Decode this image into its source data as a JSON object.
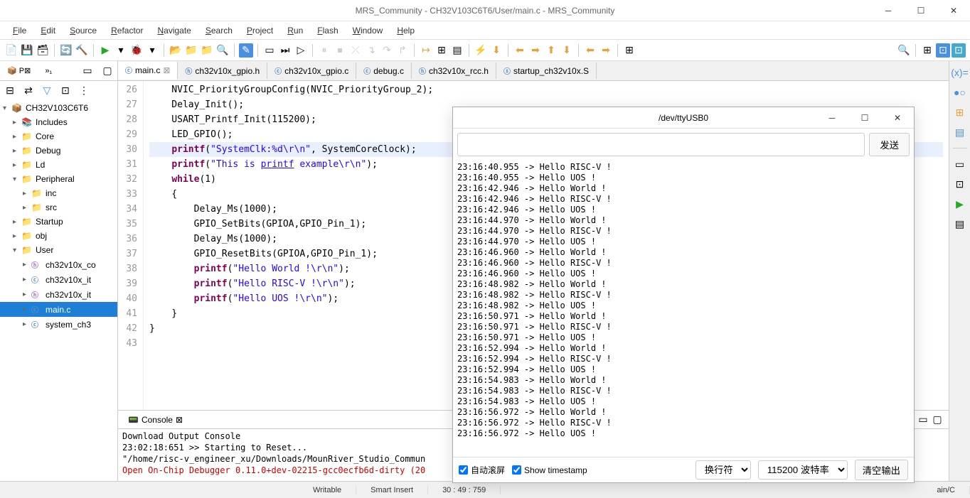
{
  "window": {
    "title": "MRS_Community - CH32V103C6T6/User/main.c - MRS_Community"
  },
  "menu": {
    "items": [
      "File",
      "Edit",
      "Source",
      "Refactor",
      "Navigate",
      "Search",
      "Project",
      "Run",
      "Flash",
      "Window",
      "Help"
    ]
  },
  "project_tree": {
    "root": "CH32V103C6T6",
    "items": [
      {
        "label": "Includes",
        "level": 1,
        "icon": "lib",
        "arrow": "▸"
      },
      {
        "label": "Core",
        "level": 1,
        "icon": "folder",
        "arrow": "▸"
      },
      {
        "label": "Debug",
        "level": 1,
        "icon": "folder",
        "arrow": "▸"
      },
      {
        "label": "Ld",
        "level": 1,
        "icon": "folder",
        "arrow": "▸"
      },
      {
        "label": "Peripheral",
        "level": 1,
        "icon": "folder",
        "arrow": "▾"
      },
      {
        "label": "inc",
        "level": 2,
        "icon": "folder",
        "arrow": "▸"
      },
      {
        "label": "src",
        "level": 2,
        "icon": "folder",
        "arrow": "▸"
      },
      {
        "label": "Startup",
        "level": 1,
        "icon": "folder",
        "arrow": "▸"
      },
      {
        "label": "obj",
        "level": 1,
        "icon": "folder",
        "arrow": "▸"
      },
      {
        "label": "User",
        "level": 1,
        "icon": "folder",
        "arrow": "▾"
      },
      {
        "label": "ch32v10x_co",
        "level": 2,
        "icon": "h",
        "arrow": "▸"
      },
      {
        "label": "ch32v10x_it",
        "level": 2,
        "icon": "c",
        "arrow": "▸"
      },
      {
        "label": "ch32v10x_it",
        "level": 2,
        "icon": "h",
        "arrow": "▸"
      },
      {
        "label": "main.c",
        "level": 2,
        "icon": "c",
        "arrow": "▸",
        "selected": true
      },
      {
        "label": "system_ch3",
        "level": 2,
        "icon": "c",
        "arrow": "▸"
      }
    ]
  },
  "editor": {
    "tabs": [
      {
        "label": "main.c",
        "icon": "c",
        "active": true,
        "close": "⊠"
      },
      {
        "label": "ch32v10x_gpio.h",
        "icon": "h"
      },
      {
        "label": "ch32v10x_gpio.c",
        "icon": "c"
      },
      {
        "label": "debug.c",
        "icon": "c"
      },
      {
        "label": "ch32v10x_rcc.h",
        "icon": "h"
      },
      {
        "label": "startup_ch32v10x.S",
        "icon": "s"
      }
    ],
    "line_start": 26,
    "lines": [
      {
        "n": 26,
        "html": "    NVIC_PriorityGroupConfig(NVIC_PriorityGroup_2);"
      },
      {
        "n": 27,
        "html": "    Delay_Init();"
      },
      {
        "n": 28,
        "html": "    USART_Printf_Init(115200);"
      },
      {
        "n": 29,
        "html": "    LED_GPIO();"
      },
      {
        "n": 30,
        "html": "    <span class='kw'>printf</span>(<span class='str'>\"SystemClk:%d\\r\\n\"</span>, SystemCoreClock);",
        "hl": true
      },
      {
        "n": 31,
        "html": "    <span class='kw'>printf</span>(<span class='str'>\"This is <u>printf</u> example\\r\\n\"</span>);"
      },
      {
        "n": 32,
        "html": "    <span class='kw'>while</span>(1)"
      },
      {
        "n": 33,
        "html": "    {"
      },
      {
        "n": 34,
        "html": "        Delay_Ms(1000);"
      },
      {
        "n": 35,
        "html": "        GPIO_SetBits(GPIOA,GPIO_Pin_1);"
      },
      {
        "n": 36,
        "html": "        Delay_Ms(1000);"
      },
      {
        "n": 37,
        "html": "        GPIO_ResetBits(GPIOA,GPIO_Pin_1);"
      },
      {
        "n": 38,
        "html": "        <span class='kw'>printf</span>(<span class='str'>\"Hello World !\\r\\n\"</span>);"
      },
      {
        "n": 39,
        "html": "        <span class='kw'>printf</span>(<span class='str'>\"Hello RISC-V !\\r\\n\"</span>);"
      },
      {
        "n": 40,
        "html": "        <span class='kw'>printf</span>(<span class='str'>\"Hello UOS !\\r\\n\"</span>);"
      },
      {
        "n": 41,
        "html": "    }"
      },
      {
        "n": 42,
        "html": "}"
      },
      {
        "n": 43,
        "html": ""
      }
    ]
  },
  "console": {
    "tab_label": "Console",
    "title": "Download Output Console",
    "lines": [
      {
        "text": "23:02:18:651 >> Starting to Reset...",
        "cls": ""
      },
      {
        "text": "\"/home/risc-v_engineer_xu/Downloads/MounRiver_Studio_Commun",
        "cls": ""
      },
      {
        "text": "Open On-Chip Debugger 0.11.0+dev-02215-gcc0ecfb6d-dirty (20",
        "cls": "err"
      }
    ]
  },
  "serial": {
    "title": "/dev/ttyUSB0",
    "send_label": "发送",
    "output": [
      "23:16:40.955 -> Hello RISC-V !",
      "23:16:40.955 -> Hello UOS !",
      "23:16:42.946 -> Hello World !",
      "23:16:42.946 -> Hello RISC-V !",
      "23:16:42.946 -> Hello UOS !",
      "23:16:44.970 -> Hello World !",
      "23:16:44.970 -> Hello RISC-V !",
      "23:16:44.970 -> Hello UOS !",
      "23:16:46.960 -> Hello World !",
      "23:16:46.960 -> Hello RISC-V !",
      "23:16:46.960 -> Hello UOS !",
      "23:16:48.982 -> Hello World !",
      "23:16:48.982 -> Hello RISC-V !",
      "23:16:48.982 -> Hello UOS !",
      "23:16:50.971 -> Hello World !",
      "23:16:50.971 -> Hello RISC-V !",
      "23:16:50.971 -> Hello UOS !",
      "23:16:52.994 -> Hello World !",
      "23:16:52.994 -> Hello RISC-V !",
      "23:16:52.994 -> Hello UOS !",
      "23:16:54.983 -> Hello World !",
      "23:16:54.983 -> Hello RISC-V !",
      "23:16:54.983 -> Hello UOS !",
      "23:16:56.972 -> Hello World !",
      "23:16:56.972 -> Hello RISC-V !",
      "23:16:56.972 -> Hello UOS !"
    ],
    "auto_scroll_label": "自动滚屏",
    "show_ts_label": "Show timestamp",
    "line_ending": "换行符",
    "baud_rate": "115200 波特率",
    "clear_label": "清空输出"
  },
  "statusbar": {
    "writable": "Writable",
    "insert": "Smart Insert",
    "pos": "30 : 49 : 759",
    "path": "ain/C"
  }
}
